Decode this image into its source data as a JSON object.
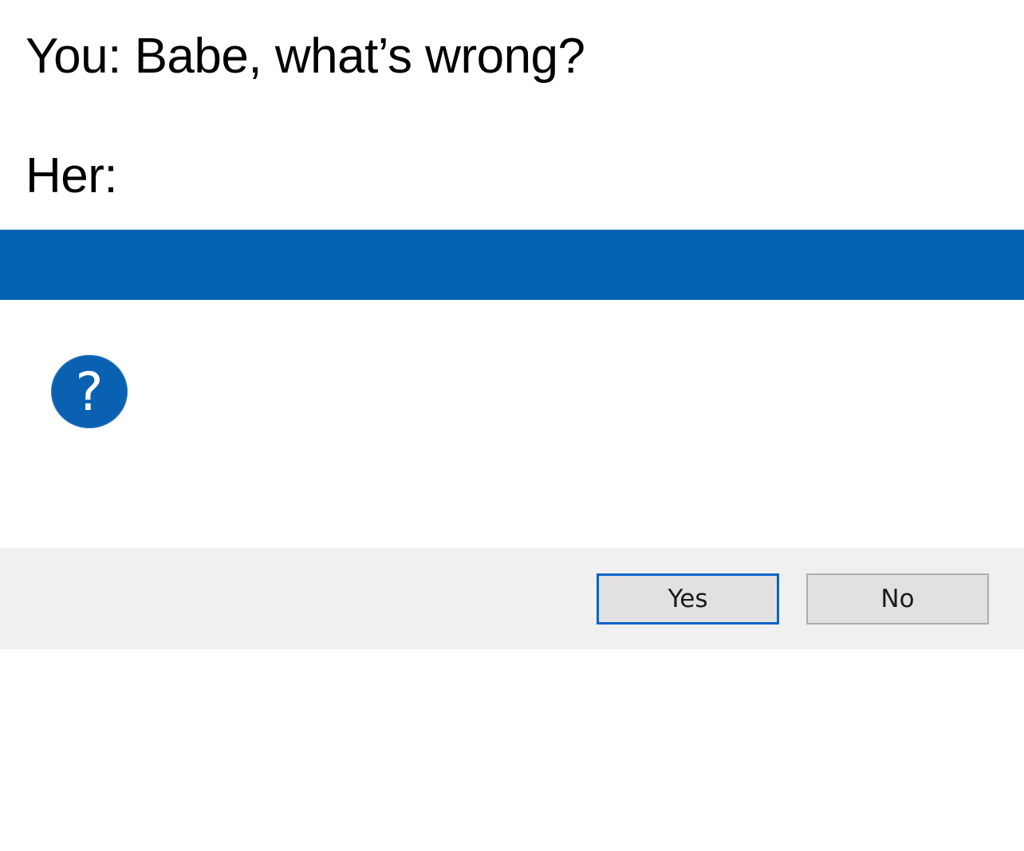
{
  "caption": {
    "line1": "You: Babe, what’s wrong?",
    "line2": "Her:"
  },
  "dialog": {
    "title": "",
    "message": "",
    "icon": "question-icon",
    "icon_glyph": "?",
    "buttons": {
      "yes_label": "Yes",
      "no_label": "No"
    },
    "colors": {
      "titlebar": "#0463b3",
      "icon": "#0a61b2",
      "footer": "#f0f0f0",
      "default_button_border": "#0a64c6"
    }
  }
}
